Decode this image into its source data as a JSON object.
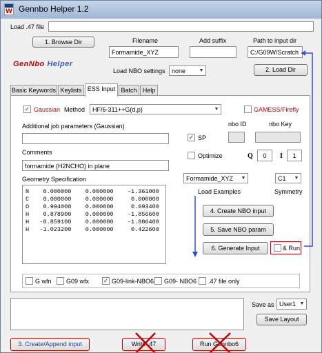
{
  "window": {
    "title": "Gennbo Helper 1.2"
  },
  "top": {
    "load_label": "Load .47 file",
    "browse_button": "1. Browse Dir",
    "filename_label": "Filename",
    "suffix_label": "Add suffix",
    "path_label": "Path to input dir",
    "filename_value": "Formamide_XYZ",
    "suffix_value": "",
    "path_value": "C:/G09W/Scratch",
    "logo_part1": "GenNbo",
    "logo_part2": "Helper",
    "nbo_settings_label": "Load NBO settings",
    "nbo_settings_value": "none",
    "load_dir_button": "2. Load Dir"
  },
  "tabs": [
    {
      "label": "Basic Keywords"
    },
    {
      "label": "Keylists"
    },
    {
      "label": "ESS Input"
    },
    {
      "label": "Batch"
    },
    {
      "label": "Help"
    }
  ],
  "ess": {
    "gaussian_label": "Gaussian",
    "method_label": "Method",
    "method_value": "HF/6-311++G(d,p)",
    "gamess_label": "GAMESS/Firefly",
    "addl_params_label": "Additional job parameters (Gaussian)",
    "addl_params_value": "",
    "sp_label": "SP",
    "optimize_label": "Optimize",
    "nbo_id_label": "nbo ID",
    "nbo_key_label": "nbo Key",
    "q_label": "Q",
    "q_value": "0",
    "i_label": "I",
    "i_value": "1",
    "comments_label": "Comments",
    "comments_value": "formamide (H2NCHO) in plane",
    "geometry_label": "Geometry Specification",
    "geometry_rows": [
      "N    0.000000    0.000000    -1.361000",
      "C    0.000000    0.000000     0.000000",
      "O    0.994000    0.000000     0.693400",
      "H    0.878900    0.000000    -1.856600",
      "H   -0.859100    0.000000    -1.886400",
      "H   -1.023200    0.000000     0.422600"
    ],
    "example_value": "Formamide_XYZ",
    "load_examples_label": "Load Examples",
    "symmetry_value": "C1",
    "symmetry_label": "Symmetry",
    "create_nbo_button": "4. Create NBO input",
    "save_nbo_button": "5. Save NBO param",
    "generate_button": "6. Generate Input",
    "run_label": "& Run",
    "g_wfn_label": "G wfn",
    "g09_wfx_label": "G09 wfx",
    "g09_link_label": "G09-link-NBO6",
    "g09_nbo6_label": "G09- NBO6",
    "file_only_label": ".47 file only"
  },
  "bottom": {
    "save_as_label": "Save as",
    "save_as_value": "User1",
    "save_layout_button": "Save Layout",
    "create_append_button": "3. Create/Append input",
    "write_button": "Write .47",
    "run_button": "Run Gennbo6"
  },
  "colors": {
    "accent_red": "#c00000",
    "arrow_blue": "#2d4fd6",
    "logo_red": "#c00000",
    "logo_blue": "#3a5bbf"
  }
}
